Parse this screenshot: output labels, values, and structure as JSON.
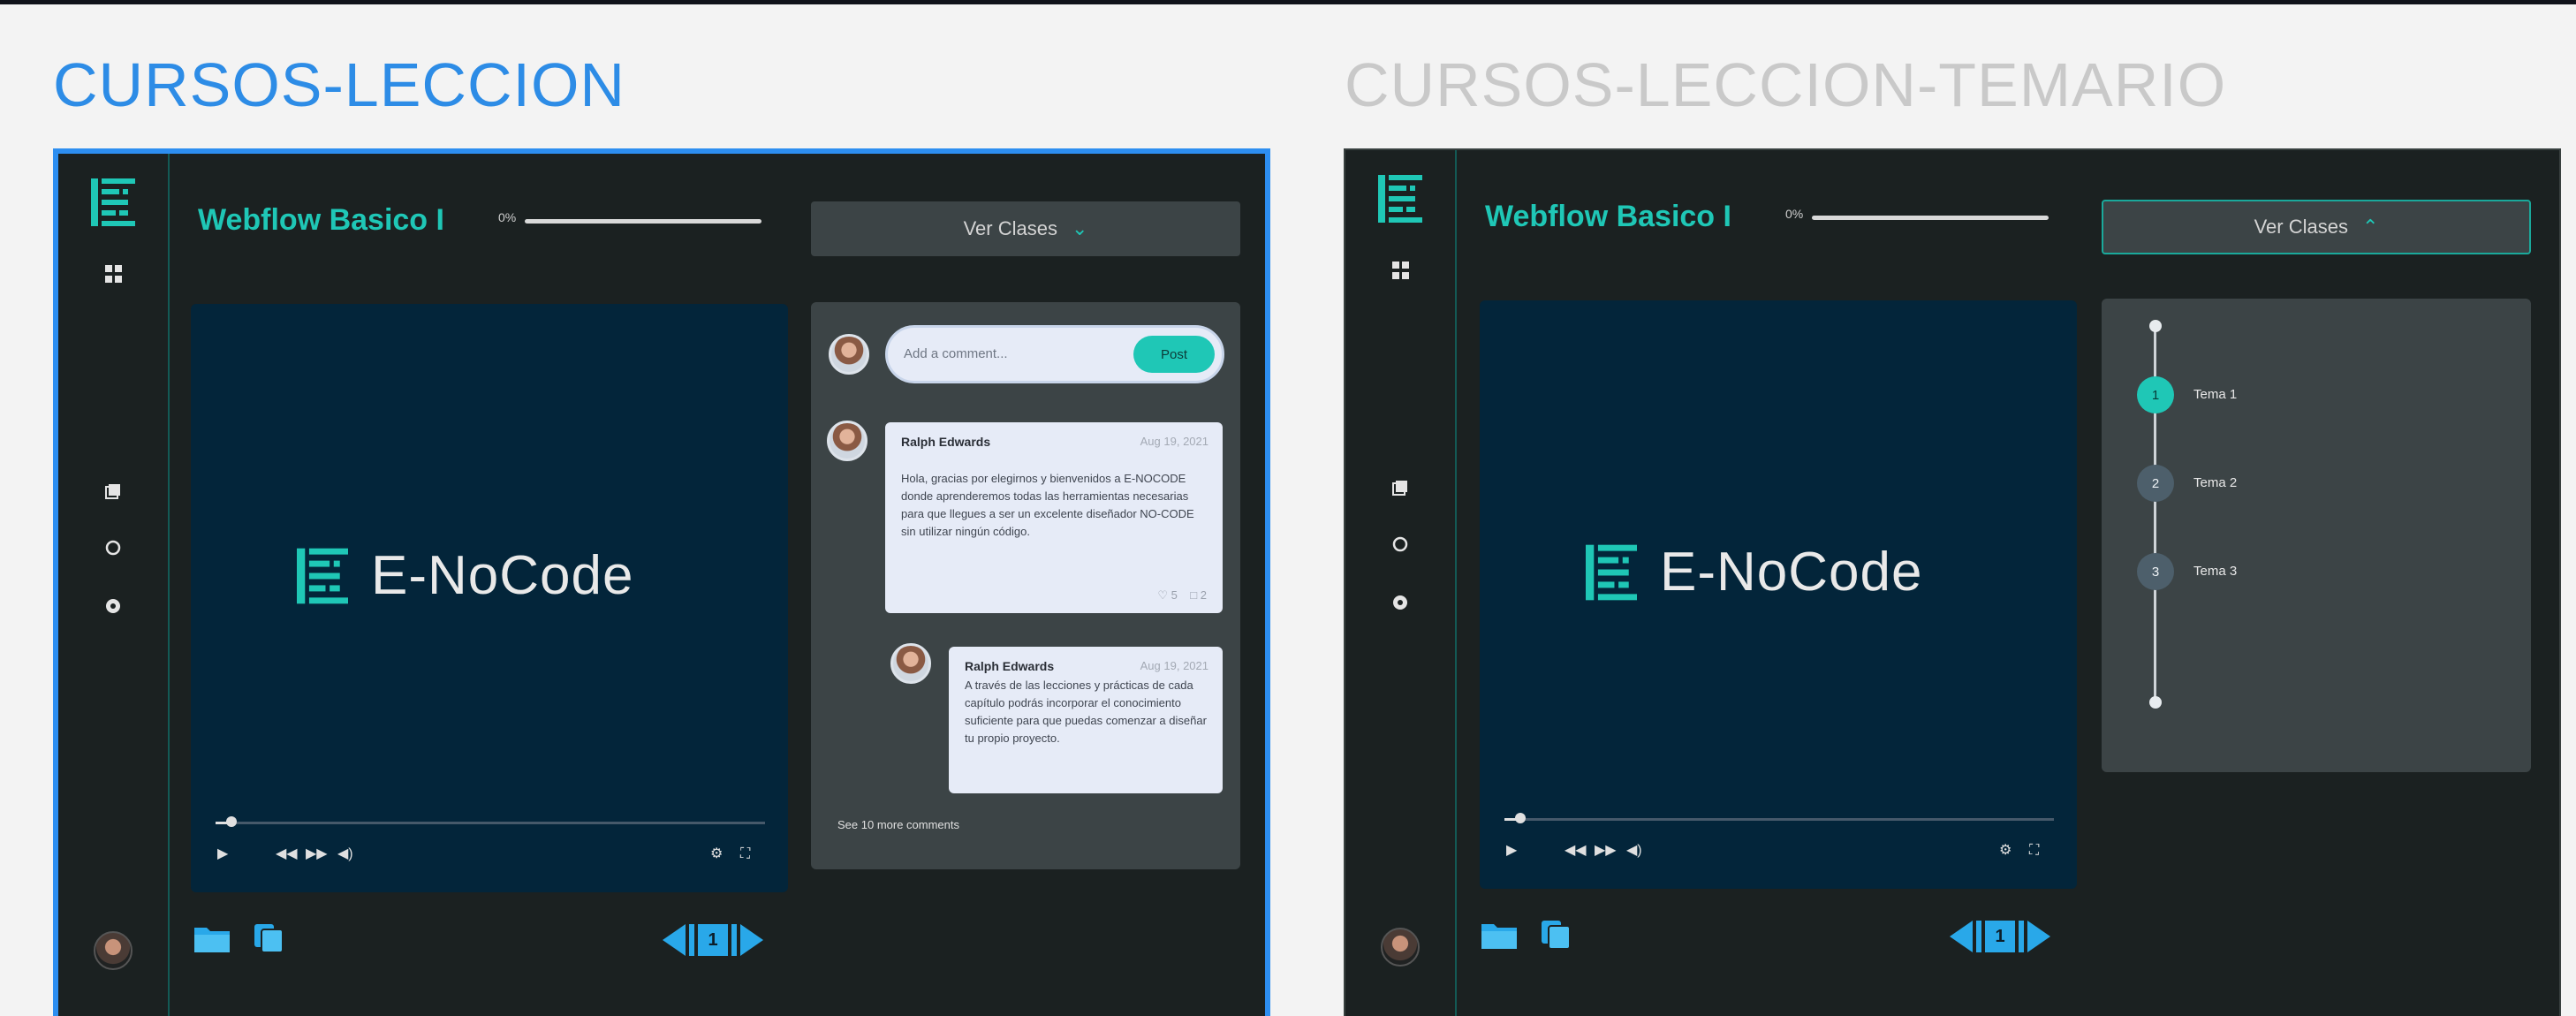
{
  "frames": [
    {
      "frame_title": "CURSOS-LECCION",
      "course_title": "Webflow Basico I",
      "progress_label": "0%",
      "progress": 0,
      "ver_clases": {
        "label": "Ver Clases",
        "chevron": "chevron-down-icon"
      },
      "video": {
        "brand": "E-NoCode"
      },
      "comments": {
        "add_placeholder": "Add a comment...",
        "post_label": "Post",
        "items": [
          {
            "author": "Ralph Edwards",
            "date": "Aug 19, 2021",
            "text": "Hola, gracias por elegirnos y bienvenidos a E-NOCODE donde aprenderemos todas las herramientas necesarias para que llegues a ser un excelente diseñador NO-CODE sin utilizar ningún código.",
            "likes": "5",
            "replies": "2"
          },
          {
            "author": "Ralph Edwards",
            "date": "Aug 19, 2021",
            "text": "A través de las lecciones y prácticas de cada capítulo podrás incorporar el conocimiento suficiente para que puedas comenzar a diseñar tu propio proyecto."
          }
        ],
        "see_more": "See 10 more comments"
      },
      "pager": {
        "page": "1"
      }
    },
    {
      "frame_title": "CURSOS-LECCION-TEMARIO",
      "course_title": "Webflow Basico I",
      "progress_label": "0%",
      "progress": 0,
      "ver_clases": {
        "label": "Ver Clases",
        "chevron": "chevron-up-icon"
      },
      "video": {
        "brand": "E-NoCode"
      },
      "temario": [
        {
          "num": "1",
          "label": "Tema 1",
          "active": true
        },
        {
          "num": "2",
          "label": "Tema 2",
          "active": false
        },
        {
          "num": "3",
          "label": "Tema 3",
          "active": false
        }
      ],
      "pager": {
        "page": "1"
      }
    }
  ],
  "colors": {
    "accent": "#1fc7b6",
    "selection": "#2d8ef0",
    "pager": "#29a8e9",
    "panel": "#3c4446",
    "video_bg": "#03253a"
  }
}
